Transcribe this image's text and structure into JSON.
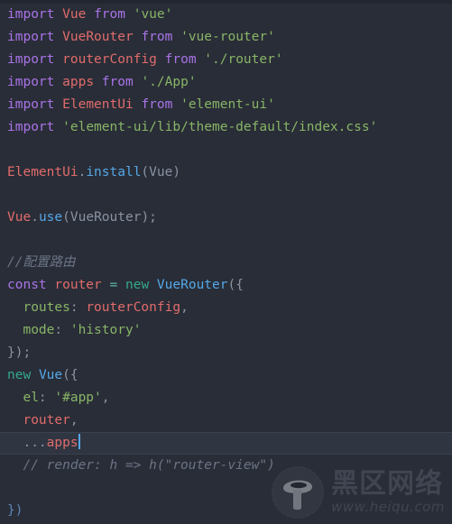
{
  "editor": {
    "background": "#292d37",
    "active_line_background": "#2f3541",
    "cursor_color": "#57a6f0",
    "font_size_px": 14.5,
    "line_height_px": 25
  },
  "code": {
    "language": "javascript",
    "lines": [
      {
        "n": 1,
        "active": false,
        "tokens": [
          {
            "t": "import",
            "c": "kw"
          },
          {
            "t": " ",
            "c": "punct"
          },
          {
            "t": "Vue",
            "c": "ident"
          },
          {
            "t": " ",
            "c": "punct"
          },
          {
            "t": "from",
            "c": "kw"
          },
          {
            "t": " ",
            "c": "punct"
          },
          {
            "t": "'vue'",
            "c": "str"
          }
        ]
      },
      {
        "n": 2,
        "active": false,
        "tokens": [
          {
            "t": "import",
            "c": "kw"
          },
          {
            "t": " ",
            "c": "punct"
          },
          {
            "t": "VueRouter",
            "c": "ident"
          },
          {
            "t": " ",
            "c": "punct"
          },
          {
            "t": "from",
            "c": "kw"
          },
          {
            "t": " ",
            "c": "punct"
          },
          {
            "t": "'vue-router'",
            "c": "str"
          }
        ]
      },
      {
        "n": 3,
        "active": false,
        "tokens": [
          {
            "t": "import",
            "c": "kw"
          },
          {
            "t": " ",
            "c": "punct"
          },
          {
            "t": "routerConfig",
            "c": "ident"
          },
          {
            "t": " ",
            "c": "punct"
          },
          {
            "t": "from",
            "c": "kw"
          },
          {
            "t": " ",
            "c": "punct"
          },
          {
            "t": "'./router'",
            "c": "str"
          }
        ]
      },
      {
        "n": 4,
        "active": false,
        "tokens": [
          {
            "t": "import",
            "c": "kw"
          },
          {
            "t": " ",
            "c": "punct"
          },
          {
            "t": "apps",
            "c": "ident"
          },
          {
            "t": " ",
            "c": "punct"
          },
          {
            "t": "from",
            "c": "kw"
          },
          {
            "t": " ",
            "c": "punct"
          },
          {
            "t": "'./App'",
            "c": "str"
          }
        ]
      },
      {
        "n": 5,
        "active": false,
        "tokens": [
          {
            "t": "import",
            "c": "kw"
          },
          {
            "t": " ",
            "c": "punct"
          },
          {
            "t": "ElementUi",
            "c": "ident"
          },
          {
            "t": " ",
            "c": "punct"
          },
          {
            "t": "from",
            "c": "kw"
          },
          {
            "t": " ",
            "c": "punct"
          },
          {
            "t": "'element-ui'",
            "c": "str"
          }
        ]
      },
      {
        "n": 6,
        "active": false,
        "tokens": [
          {
            "t": "import",
            "c": "kw"
          },
          {
            "t": " ",
            "c": "punct"
          },
          {
            "t": "'element-ui/lib/theme-default/index.css'",
            "c": "str"
          }
        ]
      },
      {
        "n": 7,
        "active": false,
        "tokens": []
      },
      {
        "n": 8,
        "active": false,
        "tokens": [
          {
            "t": "ElementUi",
            "c": "ident"
          },
          {
            "t": ".",
            "c": "punct"
          },
          {
            "t": "install",
            "c": "type"
          },
          {
            "t": "(",
            "c": "punct"
          },
          {
            "t": "Vue",
            "c": "punct"
          },
          {
            "t": ")",
            "c": "punct"
          }
        ]
      },
      {
        "n": 9,
        "active": false,
        "tokens": []
      },
      {
        "n": 10,
        "active": false,
        "tokens": [
          {
            "t": "Vue",
            "c": "ident"
          },
          {
            "t": ".",
            "c": "punct"
          },
          {
            "t": "use",
            "c": "type"
          },
          {
            "t": "(",
            "c": "punct"
          },
          {
            "t": "VueRouter",
            "c": "punct"
          },
          {
            "t": ");",
            "c": "punct"
          }
        ]
      },
      {
        "n": 11,
        "active": false,
        "tokens": []
      },
      {
        "n": 12,
        "active": false,
        "tokens": [
          {
            "t": "//配置路由",
            "c": "comment"
          }
        ]
      },
      {
        "n": 13,
        "active": false,
        "tokens": [
          {
            "t": "const",
            "c": "kw"
          },
          {
            "t": " ",
            "c": "punct"
          },
          {
            "t": "router",
            "c": "ident"
          },
          {
            "t": " ",
            "c": "punct"
          },
          {
            "t": "=",
            "c": "op"
          },
          {
            "t": " ",
            "c": "punct"
          },
          {
            "t": "new",
            "c": "kw2"
          },
          {
            "t": " ",
            "c": "punct"
          },
          {
            "t": "VueRouter",
            "c": "type"
          },
          {
            "t": "({",
            "c": "punct"
          }
        ]
      },
      {
        "n": 14,
        "active": false,
        "tokens": [
          {
            "t": "  routes",
            "c": "prop"
          },
          {
            "t": ": ",
            "c": "punct"
          },
          {
            "t": "routerConfig",
            "c": "ident"
          },
          {
            "t": ",",
            "c": "punct"
          }
        ]
      },
      {
        "n": 15,
        "active": false,
        "tokens": [
          {
            "t": "  mode",
            "c": "prop"
          },
          {
            "t": ": ",
            "c": "punct"
          },
          {
            "t": "'history'",
            "c": "str"
          }
        ]
      },
      {
        "n": 16,
        "active": false,
        "tokens": [
          {
            "t": "});",
            "c": "punct"
          }
        ]
      },
      {
        "n": 17,
        "active": false,
        "tokens": [
          {
            "t": "new",
            "c": "kw2"
          },
          {
            "t": " ",
            "c": "punct"
          },
          {
            "t": "Vue",
            "c": "type"
          },
          {
            "t": "({",
            "c": "punct"
          }
        ]
      },
      {
        "n": 18,
        "active": false,
        "tokens": [
          {
            "t": "  el",
            "c": "prop"
          },
          {
            "t": ": ",
            "c": "punct"
          },
          {
            "t": "'#app'",
            "c": "str"
          },
          {
            "t": ",",
            "c": "punct"
          }
        ]
      },
      {
        "n": 19,
        "active": false,
        "tokens": [
          {
            "t": "  router",
            "c": "ident"
          },
          {
            "t": ",",
            "c": "punct"
          }
        ]
      },
      {
        "n": 20,
        "active": true,
        "cursor": true,
        "tokens": [
          {
            "t": "  ...",
            "c": "punct"
          },
          {
            "t": "apps",
            "c": "ident"
          }
        ]
      },
      {
        "n": 21,
        "active": false,
        "tokens": [
          {
            "t": "  // render: h => h(\"router-view\")",
            "c": "comment"
          }
        ]
      },
      {
        "n": 22,
        "active": false,
        "tokens": []
      },
      {
        "n": 23,
        "active": false,
        "tokens": [
          {
            "t": "})",
            "c": "punct2"
          }
        ]
      }
    ]
  },
  "watermark": {
    "logo_icon": "mushroom-logo-icon",
    "brand_cn": "黑区网络",
    "url": "www.heiqu.com"
  }
}
